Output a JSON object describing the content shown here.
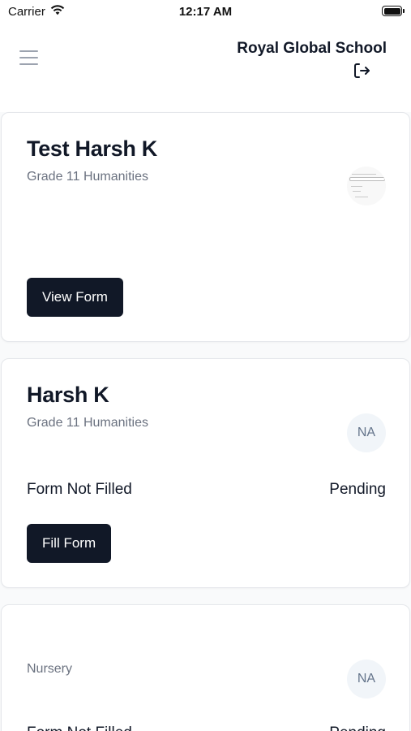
{
  "status_bar": {
    "carrier": "Carrier",
    "time": "12:17 AM"
  },
  "header": {
    "school_name": "Royal Global School",
    "menu_icon": "hamburger-menu-icon",
    "logout_icon": "logout-icon"
  },
  "students": [
    {
      "name": "Test Harsh K",
      "grade": "Grade 11 Humanities",
      "avatar_type": "form-thumbnail",
      "button_label": "View Form"
    },
    {
      "name": "Harsh K",
      "grade": "Grade 11 Humanities",
      "avatar_initials": "NA",
      "form_status": "Form Not Filled",
      "approval_status": "Pending",
      "button_label": "Fill Form"
    },
    {
      "name": "",
      "grade": "Nursery",
      "avatar_initials": "NA",
      "form_status": "Form Not Filled",
      "approval_status": "Pending"
    }
  ],
  "colors": {
    "button_bg": "#111827",
    "muted_text": "#6b7280",
    "page_bg": "#f9fafb"
  }
}
